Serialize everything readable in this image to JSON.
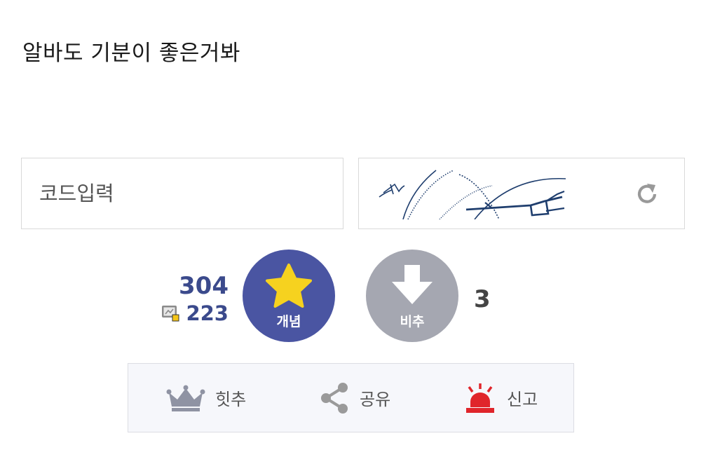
{
  "post": {
    "text": "알바도 기분이 좋은거봐"
  },
  "captcha": {
    "placeholder": "코드입력",
    "value": "",
    "refresh_icon": "refresh-icon"
  },
  "vote": {
    "up_count": "304",
    "fixed_count": "223",
    "up_label": "개념",
    "down_label": "비추",
    "down_count": "3",
    "up_color": "#4a55a2",
    "star_color": "#f6d21f",
    "down_color": "#a5a7b1",
    "count_color": "#3b4a8c"
  },
  "actions": {
    "best_label": "힛추",
    "share_label": "공유",
    "report_label": "신고",
    "report_color": "#e0252b"
  }
}
